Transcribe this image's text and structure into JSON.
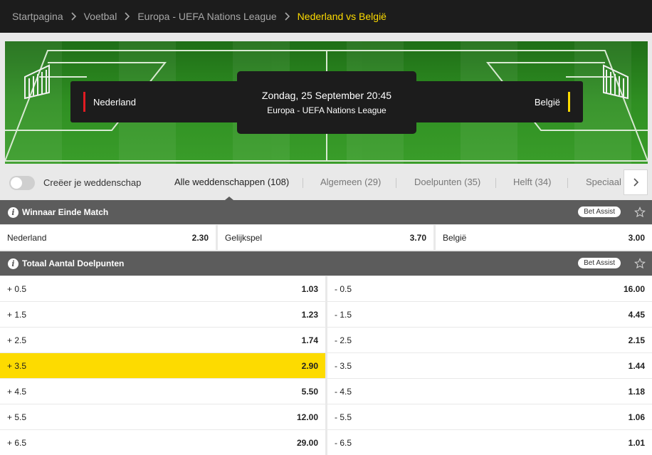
{
  "breadcrumb": {
    "items": [
      "Startpagina",
      "Voetbal",
      "Europa - UEFA Nations League"
    ],
    "current": "Nederland vs België"
  },
  "match": {
    "home": "Nederland",
    "away": "België",
    "date": "Zondag, 25 September 20:45",
    "competition": "Europa - UEFA Nations League",
    "home_color": "#e11b22",
    "away_color": "#fddb00"
  },
  "tabs": {
    "toggle_label": "Creëer je weddenschap",
    "items": [
      "Alle weddenschappen (108)",
      "Algemeen (29)",
      "Doelpunten (35)",
      "Helft (34)",
      "Speciaal ("
    ],
    "active_index": 0
  },
  "markets": [
    {
      "title": "Winnaar Einde Match",
      "badge": "Bet Assist",
      "outcomes": [
        {
          "label": "Nederland",
          "price": "2.30"
        },
        {
          "label": "Gelijkspel",
          "price": "3.70"
        },
        {
          "label": "België",
          "price": "3.00"
        }
      ]
    },
    {
      "title": "Totaal Aantal Doelpunten",
      "badge": "Bet Assist",
      "rows": [
        {
          "over": "+ 0.5",
          "over_price": "1.03",
          "under": "- 0.5",
          "under_price": "16.00"
        },
        {
          "over": "+ 1.5",
          "over_price": "1.23",
          "under": "- 1.5",
          "under_price": "4.45"
        },
        {
          "over": "+ 2.5",
          "over_price": "1.74",
          "under": "- 2.5",
          "under_price": "2.15"
        },
        {
          "over": "+ 3.5",
          "over_price": "2.90",
          "under": "- 3.5",
          "under_price": "1.44",
          "selected": "over"
        },
        {
          "over": "+ 4.5",
          "over_price": "5.50",
          "under": "- 4.5",
          "under_price": "1.18"
        },
        {
          "over": "+ 5.5",
          "over_price": "12.00",
          "under": "- 5.5",
          "under_price": "1.06"
        },
        {
          "over": "+ 6.5",
          "over_price": "29.00",
          "under": "- 6.5",
          "under_price": "1.01"
        }
      ]
    }
  ]
}
